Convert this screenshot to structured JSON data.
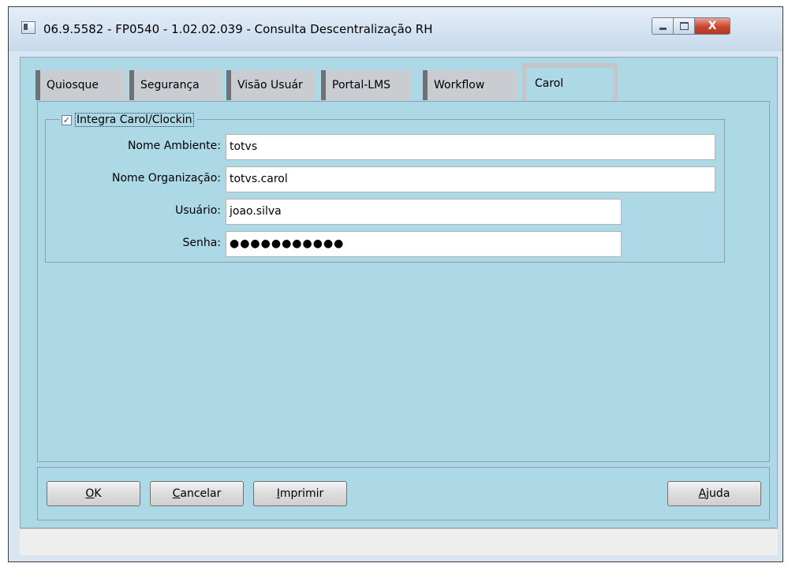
{
  "window": {
    "title": "06.9.5582 - FP0540 - 1.02.02.039 - Consulta Descentralização RH",
    "close_glyph": "X"
  },
  "tabs": [
    {
      "label": "Quiosque"
    },
    {
      "label": "Segurança"
    },
    {
      "label": "Visão Usuár"
    },
    {
      "label": "Portal-LMS"
    },
    {
      "label": "Workflow"
    },
    {
      "label": "Carol",
      "active": true
    }
  ],
  "carol_group": {
    "checkbox_label": "Integra Carol/Clockin",
    "checked": true,
    "check_glyph": "✓",
    "fields": {
      "nome_ambiente": {
        "label": "Nome Ambiente:",
        "value": "totvs"
      },
      "nome_organizacao": {
        "label": "Nome Organização:",
        "value": "totvs.carol"
      },
      "usuario": {
        "label": "Usuário:",
        "value": "joao.silva"
      },
      "senha": {
        "label": "Senha:",
        "value": "●●●●●●●●●●●"
      }
    }
  },
  "buttons": {
    "ok": {
      "underlined": "O",
      "rest": "K"
    },
    "cancelar": {
      "underlined": "C",
      "rest": "ancelar"
    },
    "imprimir": {
      "underlined": "I",
      "rest": "mprimir"
    },
    "ajuda": {
      "underlined": "A",
      "rest": "juda"
    }
  }
}
